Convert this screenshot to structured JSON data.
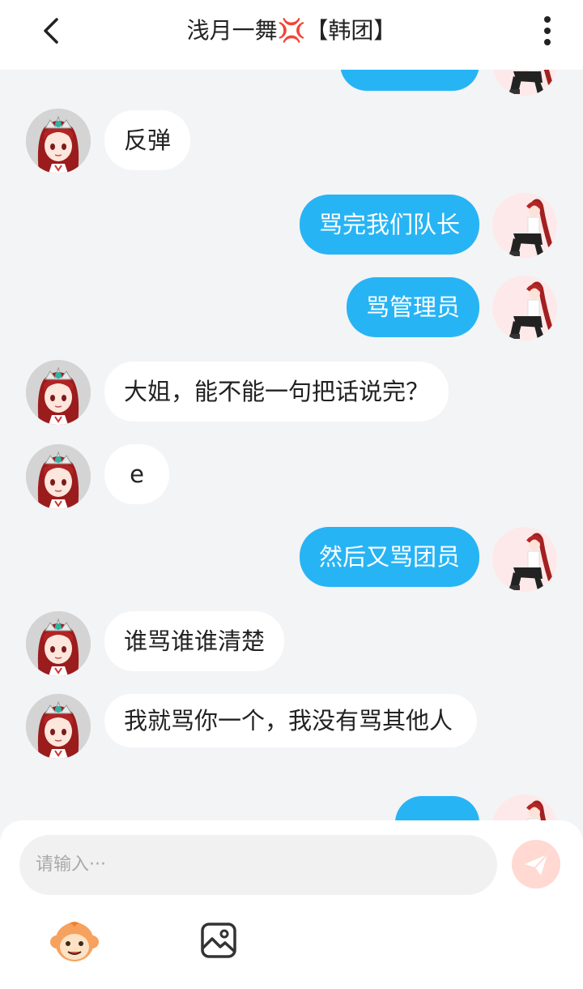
{
  "header": {
    "title": "浅月一舞💢【韩团】",
    "back_icon": "chevron-left-icon",
    "menu_icon": "more-vertical-icon"
  },
  "messages": [
    {
      "side": "right",
      "text": "",
      "partial": true
    },
    {
      "side": "left",
      "text": "反弹"
    },
    {
      "side": "right",
      "text": "骂完我们队长"
    },
    {
      "side": "right",
      "text": "骂管理员"
    },
    {
      "side": "left",
      "text": "大姐，能不能一句把话说完？"
    },
    {
      "side": "left",
      "text": "e"
    },
    {
      "side": "right",
      "text": "然后又骂团员"
    },
    {
      "side": "left",
      "text": "谁骂谁谁清楚"
    },
    {
      "side": "left",
      "text": "我就骂你一个，我没有骂其他人"
    },
    {
      "side": "right",
      "text": "",
      "partial": true
    }
  ],
  "composer": {
    "placeholder": "请输入···",
    "send_icon": "paper-plane-icon",
    "emoji_icon": "monkey-emoji-icon",
    "image_icon": "image-icon"
  },
  "colors": {
    "outgoing_bubble": "#27b4f5",
    "incoming_bubble": "#ffffff",
    "background": "#f3f4f6",
    "send_button": "#ffd9d2"
  }
}
